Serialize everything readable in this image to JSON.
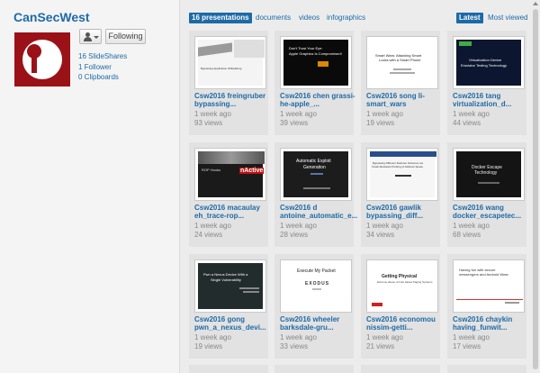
{
  "profile": {
    "name": "CanSecWest",
    "following_label": "Following",
    "slideshares": "16 SlideShares",
    "followers": "1 Follower",
    "clipboards": "0 Clipboards"
  },
  "tabs": {
    "presentations": "16 presentations",
    "documents": "documents",
    "videos": "videos",
    "infographics": "infographics",
    "latest": "Latest",
    "most_viewed": "Most viewed"
  },
  "cards": [
    {
      "title": "Csw2016 freingruber bypassing...",
      "date": "1 week ago",
      "views": "93 views"
    },
    {
      "title": "Csw2016 chen grassi-he-apple_...",
      "date": "1 week ago",
      "views": "39 views"
    },
    {
      "title": "Csw2016 song li-smart_wars",
      "date": "1 week ago",
      "views": "19 views"
    },
    {
      "title": "Csw2016 tang virtualization_d...",
      "date": "1 week ago",
      "views": "44 views"
    },
    {
      "title": "Csw2016 macaulay eh_trace-rop...",
      "date": "1 week ago",
      "views": "24 views"
    },
    {
      "title": "Csw2016 d antoine_automatic_e...",
      "date": "1 week ago",
      "views": "28 views"
    },
    {
      "title": "Csw2016 gawlik bypassing_diff...",
      "date": "1 week ago",
      "views": "34 views"
    },
    {
      "title": "Csw2016 wang docker_escapetec...",
      "date": "1 week ago",
      "views": "68 views"
    },
    {
      "title": "Csw2016 gong pwn_a_nexus_devi...",
      "date": "1 week ago",
      "views": "19 views"
    },
    {
      "title": "Csw2016 wheeler barksdale-gru...",
      "date": "1 week ago",
      "views": "33 views"
    },
    {
      "title": "Csw2016 economou nissim-getti...",
      "date": "1 week ago",
      "views": "21 views"
    },
    {
      "title": "Csw2016 chaykin having_funwit...",
      "date": "1 week ago",
      "views": "17 views"
    }
  ],
  "slides": {
    "s0": "Bypassing Application Whitelisting",
    "s1_a": "Don't Trust Your Eye:",
    "s1_b": "Apple Graphics Is Compromised!",
    "s2_a": "Smart Wars: Attacking Smart",
    "s2_b": "Locks with a Smart Phone",
    "s3_a": "Virtualization Device",
    "s3_b": "Emulator Testing Technology",
    "s4_a": "ROP Hooks",
    "s4_b": "nActive",
    "s5_a": "Automatic Exploit",
    "s5_b": "Generation",
    "s6_a": "Bypassing Different Defense Schemes via",
    "s6_b": "Crash-Resistant Probing of Address Space",
    "s7_a": "Docker Escape",
    "s7_b": "Technology",
    "s8_a": "Pwn a Nexus Device With a",
    "s8_b": "Single Vulnerability",
    "s9_a": "Execute My Packet",
    "s9_b": "EXODUS",
    "s10_a": "Getting Physical",
    "s10_b": "Extreme abuse of Intel based Paging Systems",
    "s11_a": "Having fun with secure",
    "s11_b": "messengers and Android Wear"
  }
}
